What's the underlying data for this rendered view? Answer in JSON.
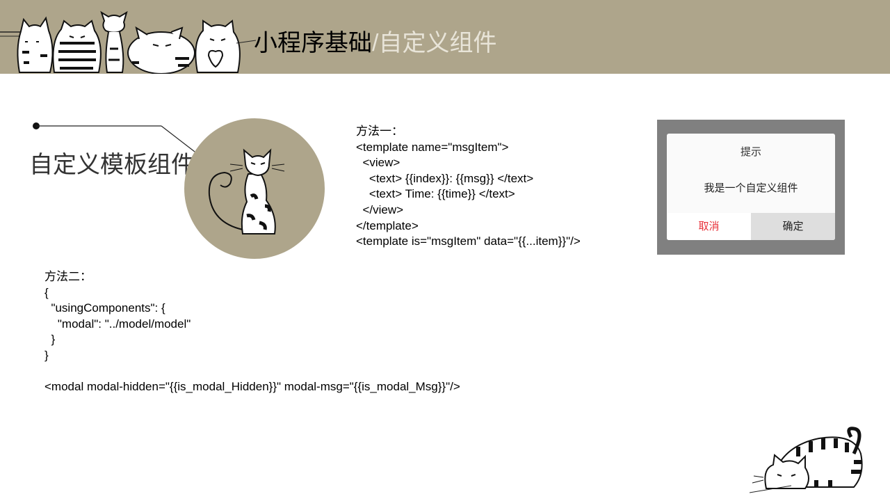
{
  "header": {
    "title_main": "小程序基础",
    "title_sub": "/自定义组件",
    "background_color": "#aea58b"
  },
  "section": {
    "heading": "自定义模板组件",
    "circle_color": "#aea58b"
  },
  "method_one": {
    "code": "方法一：\n<template name=\"msgItem\">\n  <view>\n    <text> {{index}}: {{msg}} </text>\n    <text> Time: {{time}} </text>\n  </view>\n</template>\n<template is=\"msgItem\" data=\"{{...item}}\"/>"
  },
  "method_two": {
    "code": "方法二：\n{\n  \"usingComponents\": {\n    \"modal\": \"../model/model\"\n  }\n}\n\n<modal modal-hidden=\"{{is_modal_Hidden}}\" modal-msg=\"{{is_modal_Msg}}\"/>"
  },
  "modal_preview": {
    "title": "提示",
    "message": "我是一个自定义组件",
    "cancel_label": "取消",
    "confirm_label": "确定",
    "overlay_color": "#808080",
    "cancel_color": "#e8323a"
  },
  "icons": {
    "header_cats": "cats-group-illustration",
    "circle_cat": "sitting-cat-icon",
    "bottom_cat": "lying-cat-icon"
  }
}
